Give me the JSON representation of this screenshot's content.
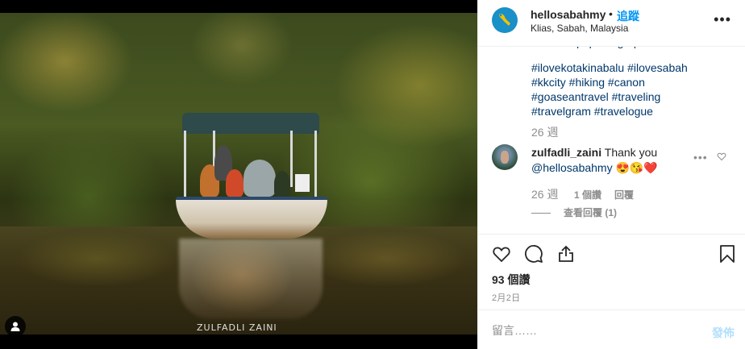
{
  "post": {
    "photo_watermark": "ZULFADLI ZAINI"
  },
  "header": {
    "username": "hellosabahmy",
    "separator": "•",
    "follow_label": "追蹤",
    "location": "Klias, Sabah, Malaysia",
    "more_icon": "ellipsis-icon"
  },
  "caption": {
    "cut_line": "#landscapephotographer",
    "lines": [
      "#ilovekotakinabalu #ilovesabah",
      "#kkcity #hiking #canon",
      "#goaseantravel #traveling",
      "#travelgram #travelogue"
    ],
    "time": "26 週"
  },
  "comment": {
    "username": "zulfadli_zaini",
    "text": "Thank you",
    "mention": "@hellosabahmy",
    "emojis": "😍😘❤️",
    "time": "26 週",
    "likes": "1 個讚",
    "reply_label": "回覆",
    "view_replies": "查看回覆 (1)"
  },
  "actions": {
    "likes_count": "93 個讚",
    "date": "2月2日"
  },
  "add_comment": {
    "placeholder": "留言……",
    "post_label": "發佈"
  },
  "colors": {
    "link": "#00376b",
    "follow": "#0095f6",
    "muted": "#8e8e8e",
    "post_disabled": "#b2dffc"
  }
}
